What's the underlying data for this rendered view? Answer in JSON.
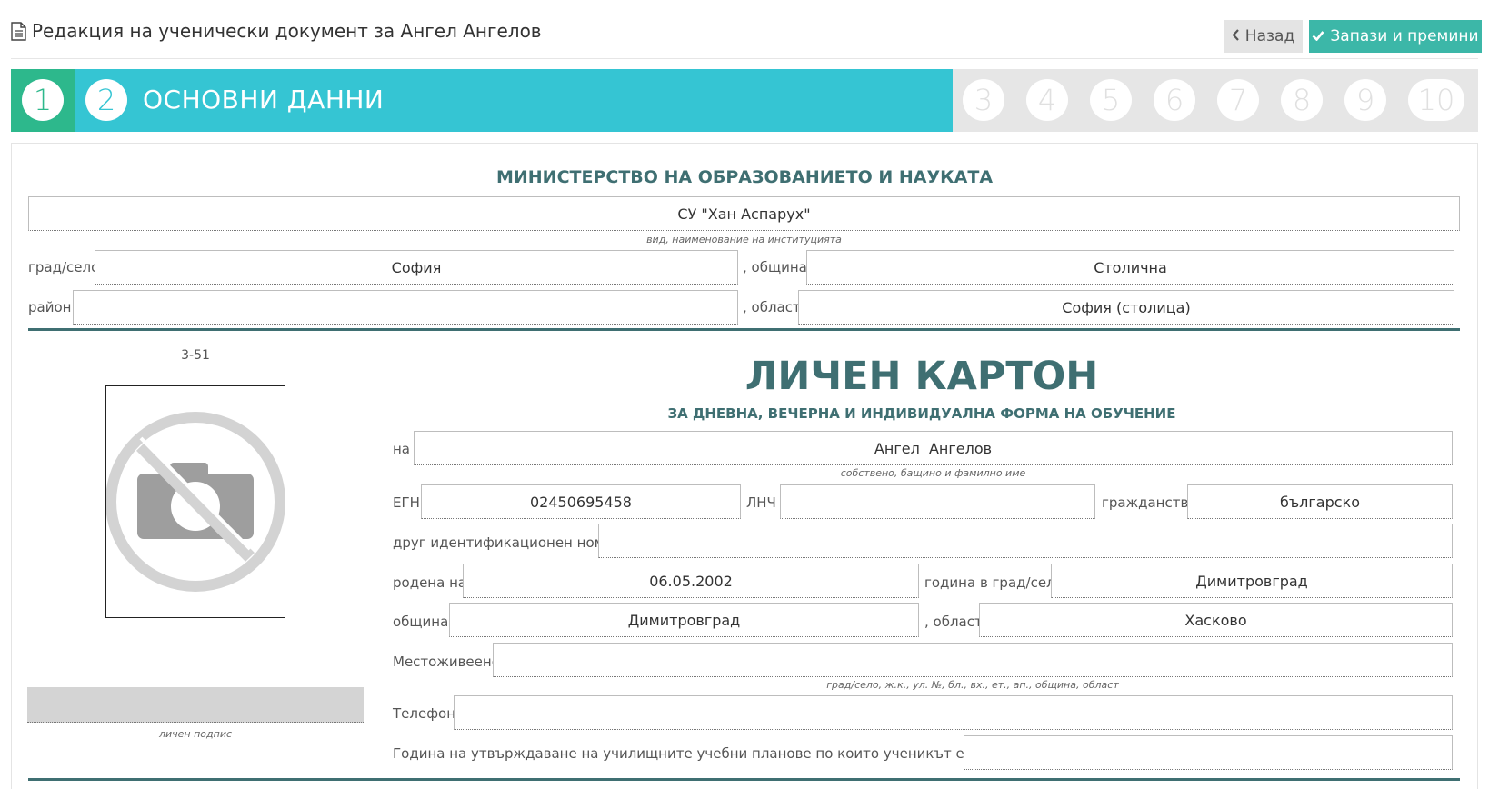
{
  "header": {
    "title": "Редакция на ученически документ за Ангел Ангелов",
    "back_label": "Назад",
    "save_label": "Запази и премини"
  },
  "steps": {
    "current_label": "ОСНОВНИ ДАННИ",
    "items": [
      "1",
      "2",
      "3",
      "4",
      "5",
      "6",
      "7",
      "8",
      "9",
      "10"
    ],
    "colors": {
      "done": "#2db88c",
      "active": "#35c5d3",
      "todo": "#e6e6e6"
    }
  },
  "institution": {
    "ministry": "МИНИСТЕРСТВО НА ОБРАЗОВАНИЕТО И НАУКАТА",
    "name": "СУ \"Хан Аспарух\"",
    "name_hint": "вид, наименование на институцията",
    "city_label": "град/село",
    "city": "София",
    "municipality_label": ", община",
    "municipality": "Столична",
    "district_label": "район",
    "district": "",
    "region_label": ", област",
    "region": "София (столица)"
  },
  "card": {
    "number": "3-51",
    "title": "ЛИЧЕН КАРТОН",
    "subtitle": "ЗА ДНЕВНА, ВЕЧЕРНА И ИНДИВИДУАЛНА ФОРМА НА ОБУЧЕНИЕ",
    "signature_hint": "личен подпис"
  },
  "student": {
    "name_label": "на",
    "name": "Ангел  Ангелов",
    "name_hint": "собствено, бащино и фамилно име",
    "egn_label": "ЕГН",
    "egn": "02450695458",
    "lnch_label": "ЛНЧ",
    "lnch": "",
    "citizenship_label": "гражданство",
    "citizenship": "българско",
    "other_id_label": "друг идентификационен номер",
    "other_id": "",
    "born_label": "родена на",
    "born_date": "06.05.2002",
    "born_place_label": "година в град/село",
    "born_place": "Димитровград",
    "municipality_label": "община",
    "municipality": "Димитровград",
    "region_label": ", област",
    "region": "Хасково",
    "residence_label": "Местоживеене",
    "residence": "",
    "residence_hint": "град/село, ж.к., ул. №, бл., вх., ет., ап., община, област",
    "phone_label": "Телефон",
    "phone": "",
    "curricula_label": "Година на утвърждаване на училищните учебни планове по които ученикът е обучаван",
    "curricula": ""
  }
}
